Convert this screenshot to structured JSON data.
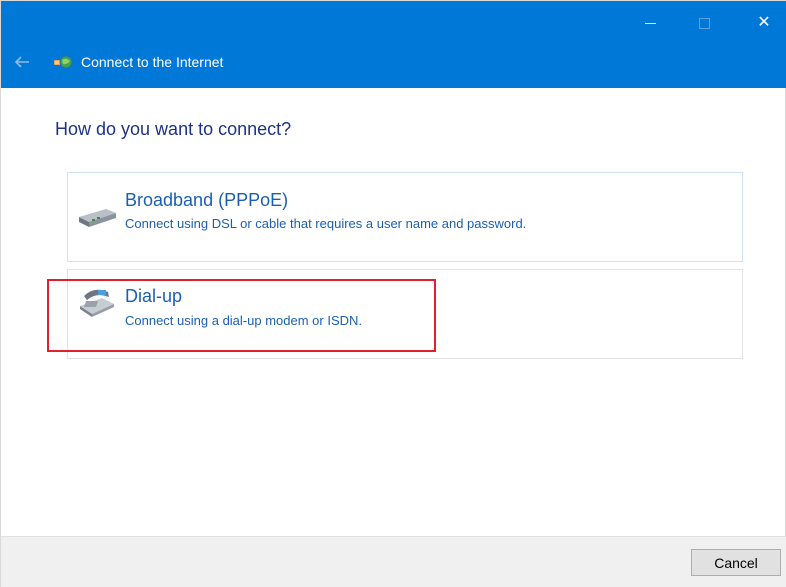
{
  "window": {
    "title": "Connect to the Internet",
    "accent_color": "#0078d7",
    "controls": {
      "minimize_icon": "minimize-icon",
      "maximize_icon": "maximize-icon",
      "close_icon": "close-icon",
      "close_glyph": "✕"
    }
  },
  "main": {
    "heading": "How do you want to connect?",
    "options": [
      {
        "icon": "broadband-modem-icon",
        "title": "Broadband (PPPoE)",
        "description": "Connect using DSL or cable that requires a user name and password."
      },
      {
        "icon": "telephone-icon",
        "title": "Dial-up",
        "description": "Connect using a dial-up modem or ISDN.",
        "highlighted": true,
        "highlight_color": "#e0202a"
      }
    ]
  },
  "footer": {
    "cancel_label": "Cancel"
  }
}
